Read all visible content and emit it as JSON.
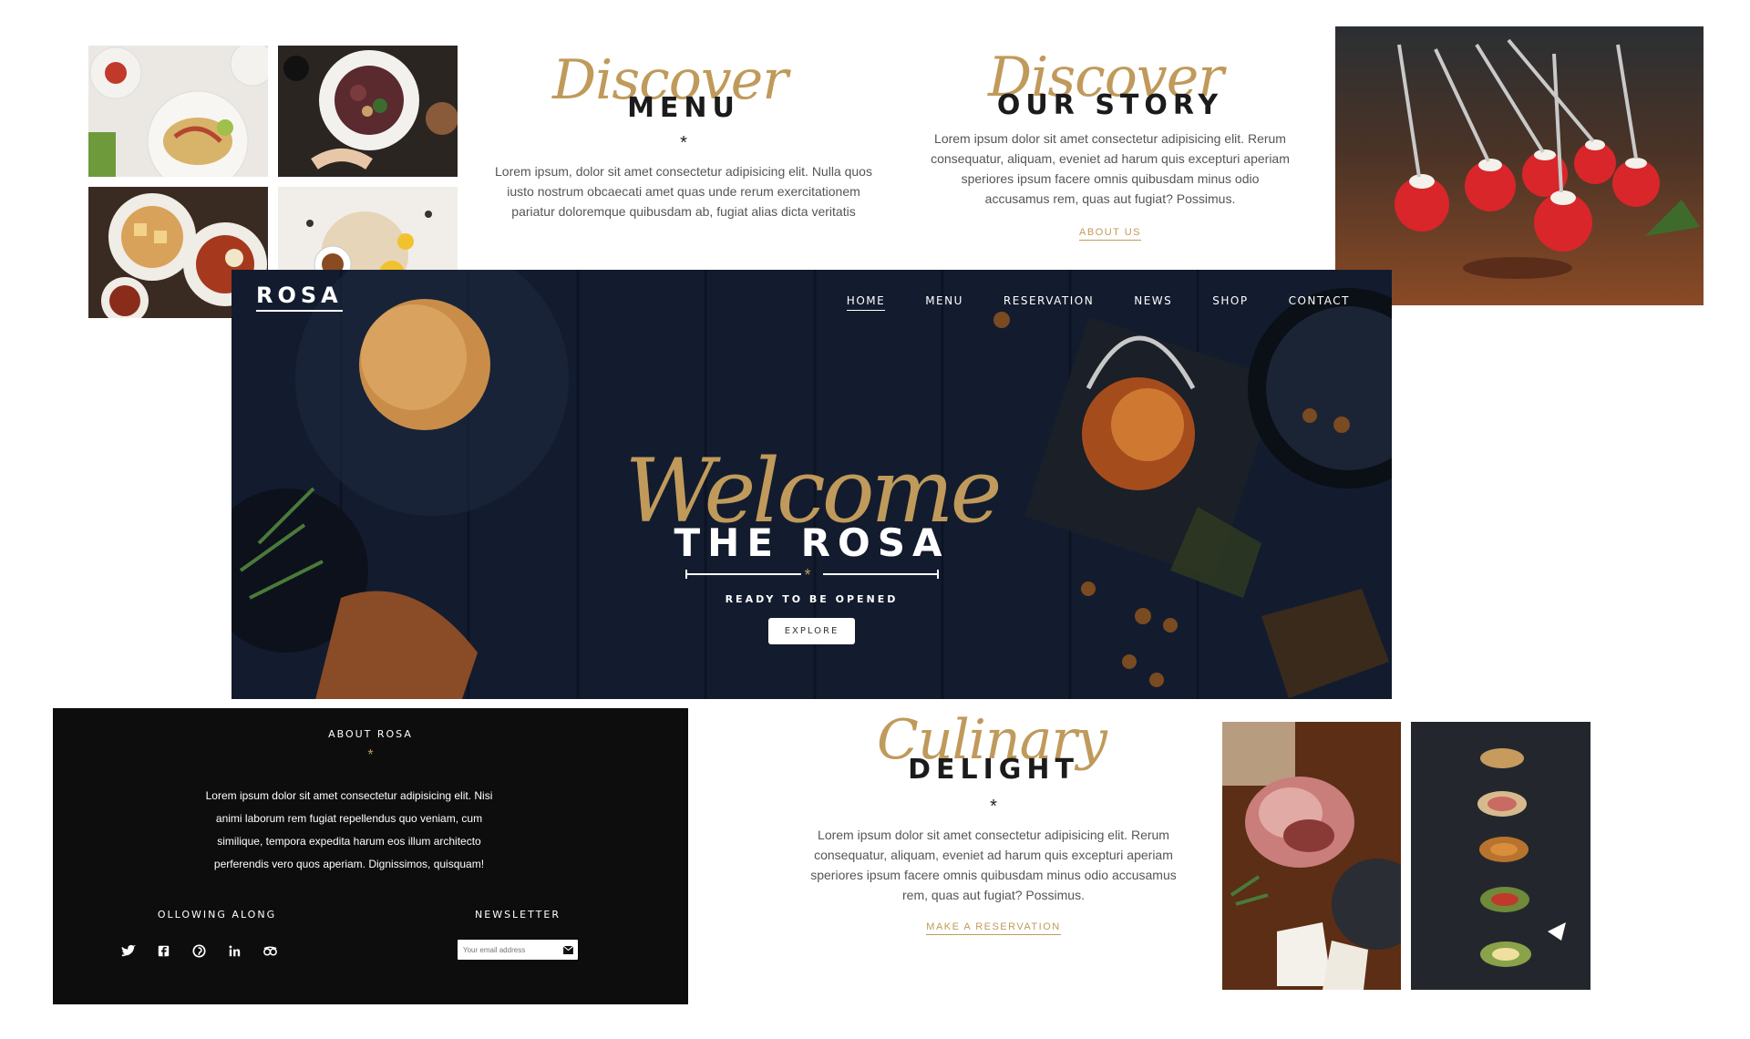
{
  "discover_menu": {
    "script": "Discover",
    "title": "MENU",
    "star": "*",
    "text": "Lorem ipsum, dolor sit amet consectetur adipisicing elit. Nulla quos iusto nostrum obcaecati amet quas unde rerum exercitationem pariatur doloremque quibusdam ab, fugiat alias dicta veritatis"
  },
  "discover_story": {
    "script": "Discover",
    "title": "OUR STORY",
    "text": "Lorem ipsum dolor sit amet consectetur adipisicing elit. Rerum consequatur, aliquam, eveniet ad harum quis excepturi aperiam speriores ipsum facere omnis quibusdam minus odio accusamus rem, quas aut fugiat? Possimus.",
    "link": "ABOUT US"
  },
  "hero": {
    "logo": "ROSA",
    "nav": [
      "HOME",
      "MENU",
      "RESERVATION",
      "NEWS",
      "SHOP",
      "CONTACT"
    ],
    "script": "Welcome",
    "title": "THE ROSA",
    "star": "*",
    "subtitle": "READY TO BE OPENED",
    "button": "EXPLORE"
  },
  "footer": {
    "about_heading": "ABOUT ROSA",
    "star": "*",
    "about_text": "Lorem ipsum dolor sit amet consectetur adipisicing elit. Nisi animi laborum rem fugiat repellendus quo veniam, cum similique, tempora expedita harum eos illum architecto perferendis vero quos aperiam. Dignissimos, quisquam!",
    "following_heading": "OLLOWING ALONG",
    "newsletter_heading": "NEWSLETTER",
    "newsletter_placeholder": "Your email address",
    "social_icons": [
      "twitter-icon",
      "facebook-icon",
      "pinterest-icon",
      "linkedin-icon",
      "tripadvisor-icon"
    ]
  },
  "culinary": {
    "script": "Culinary",
    "title": "DELIGHT",
    "star": "*",
    "text": "Lorem ipsum dolor sit amet consectetur adipisicing elit. Rerum consequatur, aliquam, eveniet ad harum quis excepturi aperiam speriores ipsum facere omnis quibusdam minus odio accusamus rem, quas aut fugiat? Possimus.",
    "link": "MAKE A RESERVATION"
  },
  "colors": {
    "gold": "#c09a5b",
    "hero_bg": "#131c2e",
    "footer_bg": "#0d0d0d"
  }
}
